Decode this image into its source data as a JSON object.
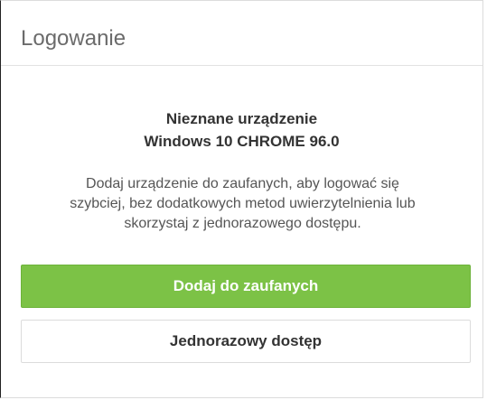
{
  "header": {
    "title": "Logowanie"
  },
  "device": {
    "heading": "Nieznane urządzenie",
    "name": "Windows 10 CHROME 96.0"
  },
  "description": {
    "lines": [
      "Dodaj urządzenie do zaufanych, aby logować się",
      "szybciej, bez dodatkowych metod uwierzytelnienia lub",
      "skorzystaj z jednorazowego dostępu."
    ]
  },
  "actions": {
    "trust_label": "Dodaj do zaufanych",
    "one_time_label": "Jednorazowy dostęp"
  },
  "colors": {
    "primary_button": "#7cc246",
    "title_text": "#6b6b6b",
    "body_text": "#555555"
  }
}
